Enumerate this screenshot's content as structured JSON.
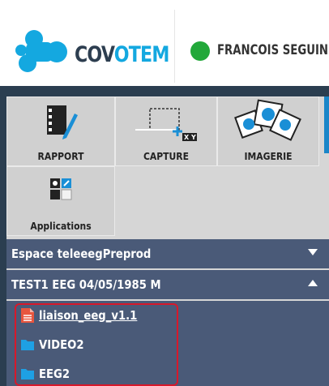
{
  "header": {
    "logo_text_a": "COV",
    "logo_text_b": "OTEM",
    "user_name": "FRANCOIS SEGUIN",
    "status_color": "#22a83a"
  },
  "tools": [
    {
      "label": "RAPPORT",
      "icon": "report-icon"
    },
    {
      "label": "CAPTURE",
      "icon": "capture-icon"
    },
    {
      "label": "IMAGERIE",
      "icon": "imagery-icon"
    },
    {
      "label": "Applications",
      "icon": "applications-icon"
    }
  ],
  "workspace": {
    "label": "Espace teleeegPreprod",
    "state": "collapsed"
  },
  "record": {
    "label": "TEST1 EEG 04/05/1985 M",
    "state": "expanded"
  },
  "files": [
    {
      "label": "liaison_eeg_v1.1",
      "type": "document"
    },
    {
      "label": "VIDEO2",
      "type": "folder"
    },
    {
      "label": "EEG2",
      "type": "folder"
    }
  ],
  "colors": {
    "panel": "#2b3e50",
    "bar": "#4a5a78",
    "accent": "#14a8e0",
    "highlight": "#d8182a"
  }
}
